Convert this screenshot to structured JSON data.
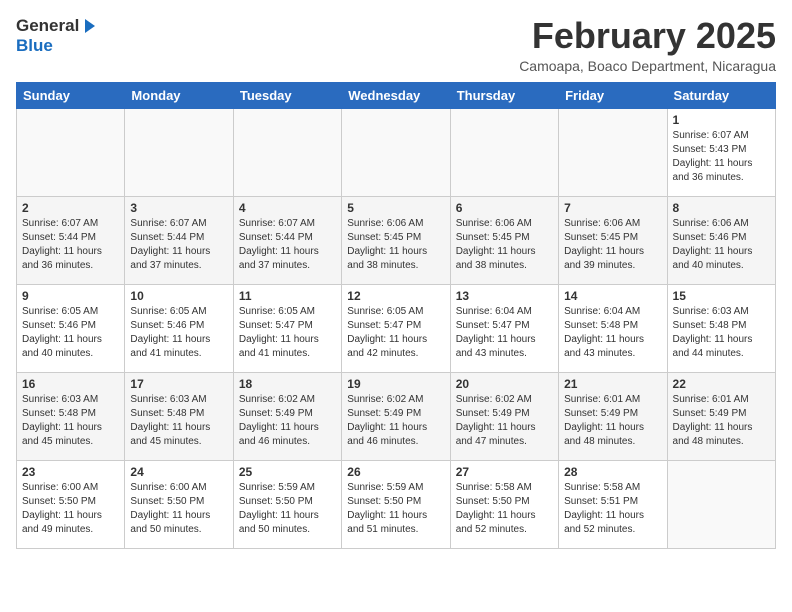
{
  "header": {
    "logo_general": "General",
    "logo_blue": "Blue",
    "month_year": "February 2025",
    "location": "Camoapa, Boaco Department, Nicaragua"
  },
  "weekdays": [
    "Sunday",
    "Monday",
    "Tuesday",
    "Wednesday",
    "Thursday",
    "Friday",
    "Saturday"
  ],
  "weeks": [
    [
      {
        "day": "",
        "text": ""
      },
      {
        "day": "",
        "text": ""
      },
      {
        "day": "",
        "text": ""
      },
      {
        "day": "",
        "text": ""
      },
      {
        "day": "",
        "text": ""
      },
      {
        "day": "",
        "text": ""
      },
      {
        "day": "1",
        "text": "Sunrise: 6:07 AM\nSunset: 5:43 PM\nDaylight: 11 hours and 36 minutes."
      }
    ],
    [
      {
        "day": "2",
        "text": "Sunrise: 6:07 AM\nSunset: 5:44 PM\nDaylight: 11 hours and 36 minutes."
      },
      {
        "day": "3",
        "text": "Sunrise: 6:07 AM\nSunset: 5:44 PM\nDaylight: 11 hours and 37 minutes."
      },
      {
        "day": "4",
        "text": "Sunrise: 6:07 AM\nSunset: 5:44 PM\nDaylight: 11 hours and 37 minutes."
      },
      {
        "day": "5",
        "text": "Sunrise: 6:06 AM\nSunset: 5:45 PM\nDaylight: 11 hours and 38 minutes."
      },
      {
        "day": "6",
        "text": "Sunrise: 6:06 AM\nSunset: 5:45 PM\nDaylight: 11 hours and 38 minutes."
      },
      {
        "day": "7",
        "text": "Sunrise: 6:06 AM\nSunset: 5:45 PM\nDaylight: 11 hours and 39 minutes."
      },
      {
        "day": "8",
        "text": "Sunrise: 6:06 AM\nSunset: 5:46 PM\nDaylight: 11 hours and 40 minutes."
      }
    ],
    [
      {
        "day": "9",
        "text": "Sunrise: 6:05 AM\nSunset: 5:46 PM\nDaylight: 11 hours and 40 minutes."
      },
      {
        "day": "10",
        "text": "Sunrise: 6:05 AM\nSunset: 5:46 PM\nDaylight: 11 hours and 41 minutes."
      },
      {
        "day": "11",
        "text": "Sunrise: 6:05 AM\nSunset: 5:47 PM\nDaylight: 11 hours and 41 minutes."
      },
      {
        "day": "12",
        "text": "Sunrise: 6:05 AM\nSunset: 5:47 PM\nDaylight: 11 hours and 42 minutes."
      },
      {
        "day": "13",
        "text": "Sunrise: 6:04 AM\nSunset: 5:47 PM\nDaylight: 11 hours and 43 minutes."
      },
      {
        "day": "14",
        "text": "Sunrise: 6:04 AM\nSunset: 5:48 PM\nDaylight: 11 hours and 43 minutes."
      },
      {
        "day": "15",
        "text": "Sunrise: 6:03 AM\nSunset: 5:48 PM\nDaylight: 11 hours and 44 minutes."
      }
    ],
    [
      {
        "day": "16",
        "text": "Sunrise: 6:03 AM\nSunset: 5:48 PM\nDaylight: 11 hours and 45 minutes."
      },
      {
        "day": "17",
        "text": "Sunrise: 6:03 AM\nSunset: 5:48 PM\nDaylight: 11 hours and 45 minutes."
      },
      {
        "day": "18",
        "text": "Sunrise: 6:02 AM\nSunset: 5:49 PM\nDaylight: 11 hours and 46 minutes."
      },
      {
        "day": "19",
        "text": "Sunrise: 6:02 AM\nSunset: 5:49 PM\nDaylight: 11 hours and 46 minutes."
      },
      {
        "day": "20",
        "text": "Sunrise: 6:02 AM\nSunset: 5:49 PM\nDaylight: 11 hours and 47 minutes."
      },
      {
        "day": "21",
        "text": "Sunrise: 6:01 AM\nSunset: 5:49 PM\nDaylight: 11 hours and 48 minutes."
      },
      {
        "day": "22",
        "text": "Sunrise: 6:01 AM\nSunset: 5:49 PM\nDaylight: 11 hours and 48 minutes."
      }
    ],
    [
      {
        "day": "23",
        "text": "Sunrise: 6:00 AM\nSunset: 5:50 PM\nDaylight: 11 hours and 49 minutes."
      },
      {
        "day": "24",
        "text": "Sunrise: 6:00 AM\nSunset: 5:50 PM\nDaylight: 11 hours and 50 minutes."
      },
      {
        "day": "25",
        "text": "Sunrise: 5:59 AM\nSunset: 5:50 PM\nDaylight: 11 hours and 50 minutes."
      },
      {
        "day": "26",
        "text": "Sunrise: 5:59 AM\nSunset: 5:50 PM\nDaylight: 11 hours and 51 minutes."
      },
      {
        "day": "27",
        "text": "Sunrise: 5:58 AM\nSunset: 5:50 PM\nDaylight: 11 hours and 52 minutes."
      },
      {
        "day": "28",
        "text": "Sunrise: 5:58 AM\nSunset: 5:51 PM\nDaylight: 11 hours and 52 minutes."
      },
      {
        "day": "",
        "text": ""
      }
    ]
  ]
}
